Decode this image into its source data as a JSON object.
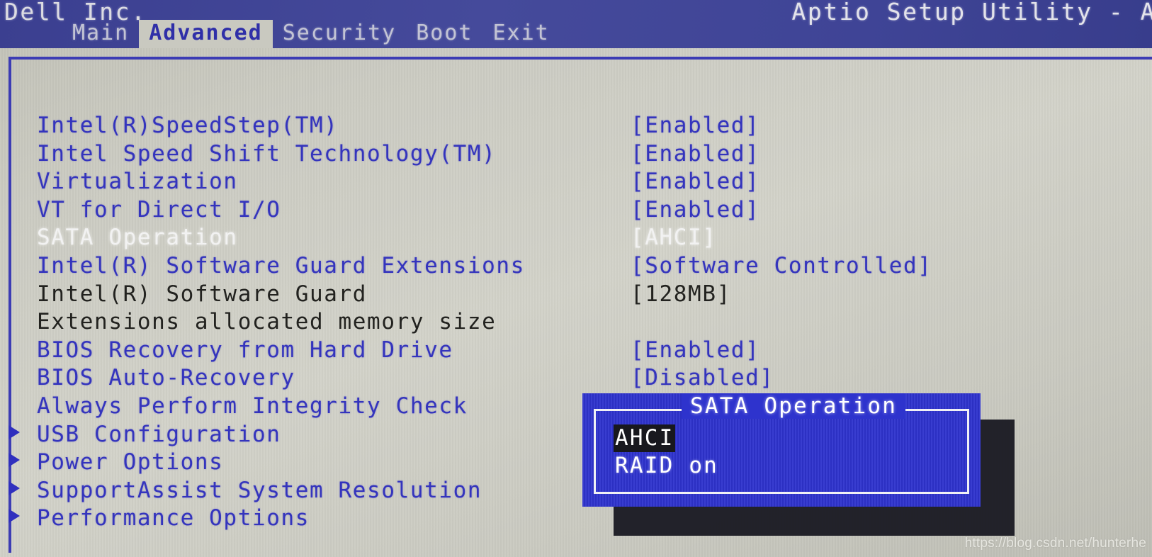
{
  "header": {
    "brand": "Dell Inc.",
    "utility_title": "Aptio Setup Utility - A",
    "band_color": "#3f4496"
  },
  "tabs": [
    {
      "label": "Main",
      "active": false
    },
    {
      "label": "Advanced",
      "active": true
    },
    {
      "label": "Security",
      "active": false
    },
    {
      "label": "Boot",
      "active": false
    },
    {
      "label": "Exit",
      "active": false
    }
  ],
  "colors": {
    "panel_background": "#c9c9c0",
    "text_blue": "#3434bd",
    "text_selected": "#f2f2f2",
    "text_disabled": "#22221f",
    "popup_blue": "#2e33cd",
    "popup_border": "#f0f0f5",
    "popup_highlight": "#18181e"
  },
  "settings": [
    {
      "label": "Intel(R)SpeedStep(TM)",
      "value": "[Enabled]",
      "submenu": false,
      "state": "normal"
    },
    {
      "label": "Intel Speed Shift Technology(TM)",
      "value": "[Enabled]",
      "submenu": false,
      "state": "normal"
    },
    {
      "label": "Virtualization",
      "value": "[Enabled]",
      "submenu": false,
      "state": "normal"
    },
    {
      "label": "VT for Direct I/O",
      "value": "[Enabled]",
      "submenu": false,
      "state": "normal"
    },
    {
      "label": "SATA Operation",
      "value": "[AHCI]",
      "submenu": false,
      "state": "selected"
    },
    {
      "label": "Intel(R) Software Guard Extensions",
      "value": "[Software Controlled]",
      "submenu": false,
      "state": "normal"
    },
    {
      "label": "Intel(R) Software Guard",
      "value": "[128MB]",
      "submenu": false,
      "state": "disabled"
    },
    {
      "label": "Extensions allocated memory size",
      "value": "",
      "submenu": false,
      "state": "disabled"
    },
    {
      "label": "BIOS Recovery from Hard Drive",
      "value": "[Enabled]",
      "submenu": false,
      "state": "normal"
    },
    {
      "label": "BIOS Auto-Recovery",
      "value": "[Disabled]",
      "submenu": false,
      "state": "normal"
    },
    {
      "label": "Always Perform Integrity Check",
      "value": "",
      "submenu": false,
      "state": "normal"
    },
    {
      "label": "USB Configuration",
      "value": "",
      "submenu": true,
      "state": "normal"
    },
    {
      "label": "Power Options",
      "value": "",
      "submenu": true,
      "state": "normal"
    },
    {
      "label": "SupportAssist System Resolution",
      "value": "",
      "submenu": true,
      "state": "normal"
    },
    {
      "label": "Performance Options",
      "value": "",
      "submenu": true,
      "state": "normal"
    }
  ],
  "popup": {
    "title": "SATA Operation",
    "options": [
      {
        "label": "AHCI",
        "selected": true
      },
      {
        "label": "RAID on",
        "selected": false
      }
    ]
  },
  "watermark": "https://blog.csdn.net/hunterhe"
}
